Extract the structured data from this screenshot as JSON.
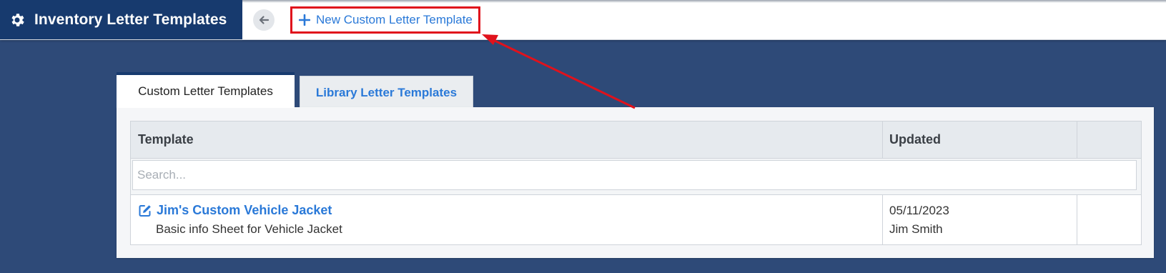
{
  "header": {
    "icon": "gear-icon",
    "title": "Inventory Letter Templates",
    "back_icon": "arrow-left-icon",
    "new_template_label": "New Custom Letter Template",
    "new_template_icon": "plus-icon"
  },
  "tabs": [
    {
      "label": "Custom Letter Templates",
      "active": true
    },
    {
      "label": "Library Letter Templates",
      "active": false
    }
  ],
  "grid": {
    "columns": [
      "Template",
      "Updated",
      ""
    ],
    "search_placeholder": "Search...",
    "rows": [
      {
        "name": "Jim's Custom Vehicle Jacket",
        "description": "Basic info Sheet for Vehicle Jacket",
        "updated_date": "05/11/2023",
        "updated_by": "Jim Smith",
        "icon": "edit-icon"
      }
    ]
  },
  "colors": {
    "brand": "#173a6e",
    "background": "#2e4a78",
    "link": "#2a79d8",
    "highlight": "#e0121c"
  }
}
